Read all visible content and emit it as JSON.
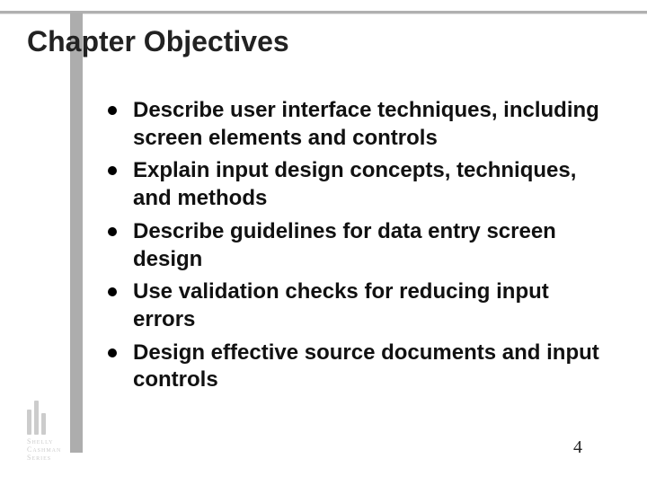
{
  "title": "Chapter Objectives",
  "bullets": [
    "Describe user interface techniques, including screen elements and controls",
    "Explain input design concepts, techniques, and methods",
    "Describe guidelines for data entry screen design",
    "Use validation checks for reducing input errors",
    "Design effective source documents and input controls"
  ],
  "page_number": "4",
  "logo": {
    "line1": "Shelly",
    "line2": "Cashman",
    "line3": "Series"
  }
}
